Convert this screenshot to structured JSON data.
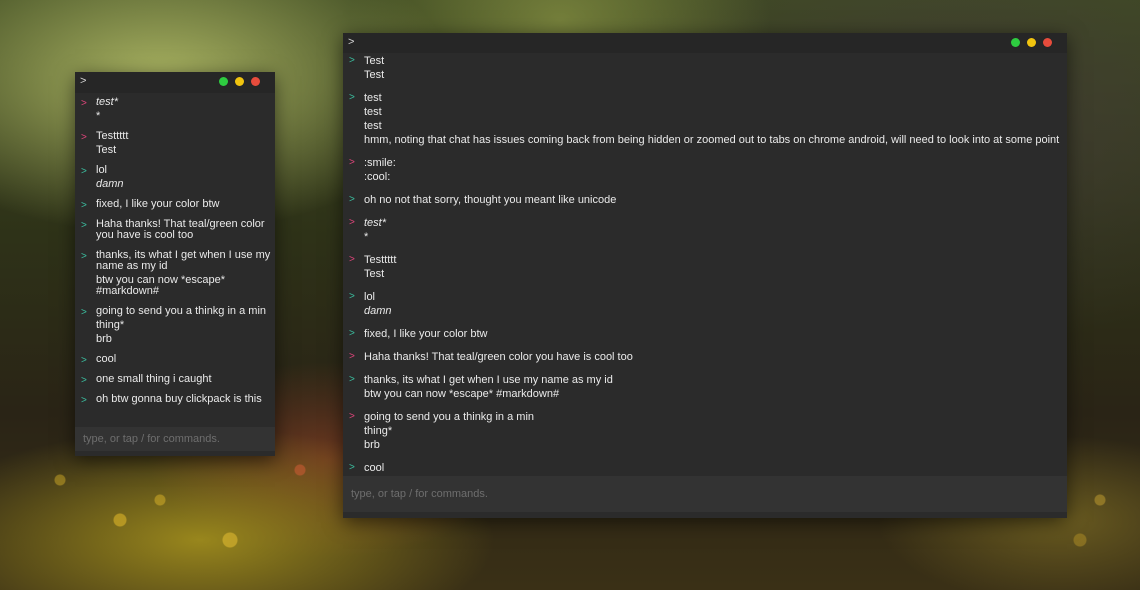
{
  "small_window": {
    "prompt": ">",
    "input_placeholder": "type, or tap / for commands.",
    "messages": [
      {
        "color": "pink",
        "lines": [
          {
            "text": "test*",
            "italic": true
          },
          {
            "text": "*"
          }
        ]
      },
      {
        "color": "pink",
        "lines": [
          {
            "text": "Testtttt"
          },
          {
            "text": "Test"
          }
        ]
      },
      {
        "color": "teal",
        "lines": [
          {
            "text": "lol"
          },
          {
            "text": "damn",
            "italic": true
          }
        ]
      },
      {
        "color": "teal",
        "lines": [
          {
            "text": "fixed, I like your color btw"
          }
        ]
      },
      {
        "color": "teal",
        "lines": [
          {
            "text": "Haha thanks! That teal/green color you have is cool too"
          }
        ]
      },
      {
        "color": "teal",
        "lines": [
          {
            "text": "thanks, its what I get when I use my name as my id"
          },
          {
            "text": "btw you can now *escape* #markdown#"
          }
        ]
      },
      {
        "color": "teal",
        "lines": [
          {
            "text": "going to send you a thinkg in a min"
          },
          {
            "text": "thing*"
          },
          {
            "text": "brb"
          }
        ]
      },
      {
        "color": "teal",
        "lines": [
          {
            "text": "cool"
          }
        ]
      },
      {
        "color": "teal",
        "lines": [
          {
            "text": "one small thing i caught"
          }
        ]
      },
      {
        "color": "teal",
        "lines": [
          {
            "text": "oh btw gonna buy clickpack is this"
          }
        ]
      }
    ]
  },
  "large_window": {
    "prompt": ">",
    "input_placeholder": "type, or tap / for commands.",
    "messages": [
      {
        "color": "teal",
        "lines": [
          {
            "text": "Test"
          },
          {
            "text": "Test"
          }
        ]
      },
      {
        "color": "teal",
        "lines": [
          {
            "text": "test"
          },
          {
            "text": "test"
          },
          {
            "text": "test"
          },
          {
            "text": "hmm, noting that chat has issues coming back from being hidden or zoomed out to tabs on chrome android, will need to look into at some point"
          }
        ]
      },
      {
        "color": "pink",
        "lines": [
          {
            "text": ":smile:"
          },
          {
            "text": ":cool:"
          }
        ]
      },
      {
        "color": "teal",
        "lines": [
          {
            "text": "oh no not that sorry, thought you meant like unicode"
          }
        ]
      },
      {
        "color": "pink",
        "lines": [
          {
            "text": "test*",
            "italic": true
          },
          {
            "text": "*"
          }
        ]
      },
      {
        "color": "pink",
        "lines": [
          {
            "text": "Testtttt"
          },
          {
            "text": "Test"
          }
        ]
      },
      {
        "color": "teal",
        "lines": [
          {
            "text": "lol"
          },
          {
            "text": "damn",
            "italic": true
          }
        ]
      },
      {
        "color": "teal",
        "lines": [
          {
            "text": "fixed, I like your color btw"
          }
        ]
      },
      {
        "color": "pink",
        "lines": [
          {
            "text": "Haha thanks! That teal/green color you have is cool too"
          }
        ]
      },
      {
        "color": "teal",
        "lines": [
          {
            "text": "thanks, its what I get when I use my name as my id"
          },
          {
            "text": "btw you can now *escape* #markdown#"
          }
        ]
      },
      {
        "color": "pink",
        "lines": [
          {
            "text": "going to send you a thinkg in a min"
          },
          {
            "text": "thing*"
          },
          {
            "text": "brb"
          }
        ]
      },
      {
        "color": "teal",
        "lines": [
          {
            "text": "cool"
          }
        ]
      }
    ]
  },
  "message_arrow": ">",
  "colors": {
    "pink_user": "#e0457b",
    "teal_user": "#3bbfa0",
    "window_bg": "#2b2b2b",
    "traffic_green": "#2ecc40",
    "traffic_yellow": "#f1c40f",
    "traffic_red": "#e74c3c"
  },
  "icons": [
    "green-window-dot-icon",
    "yellow-window-dot-icon",
    "red-window-dot-icon",
    "message-arrow-icon"
  ]
}
